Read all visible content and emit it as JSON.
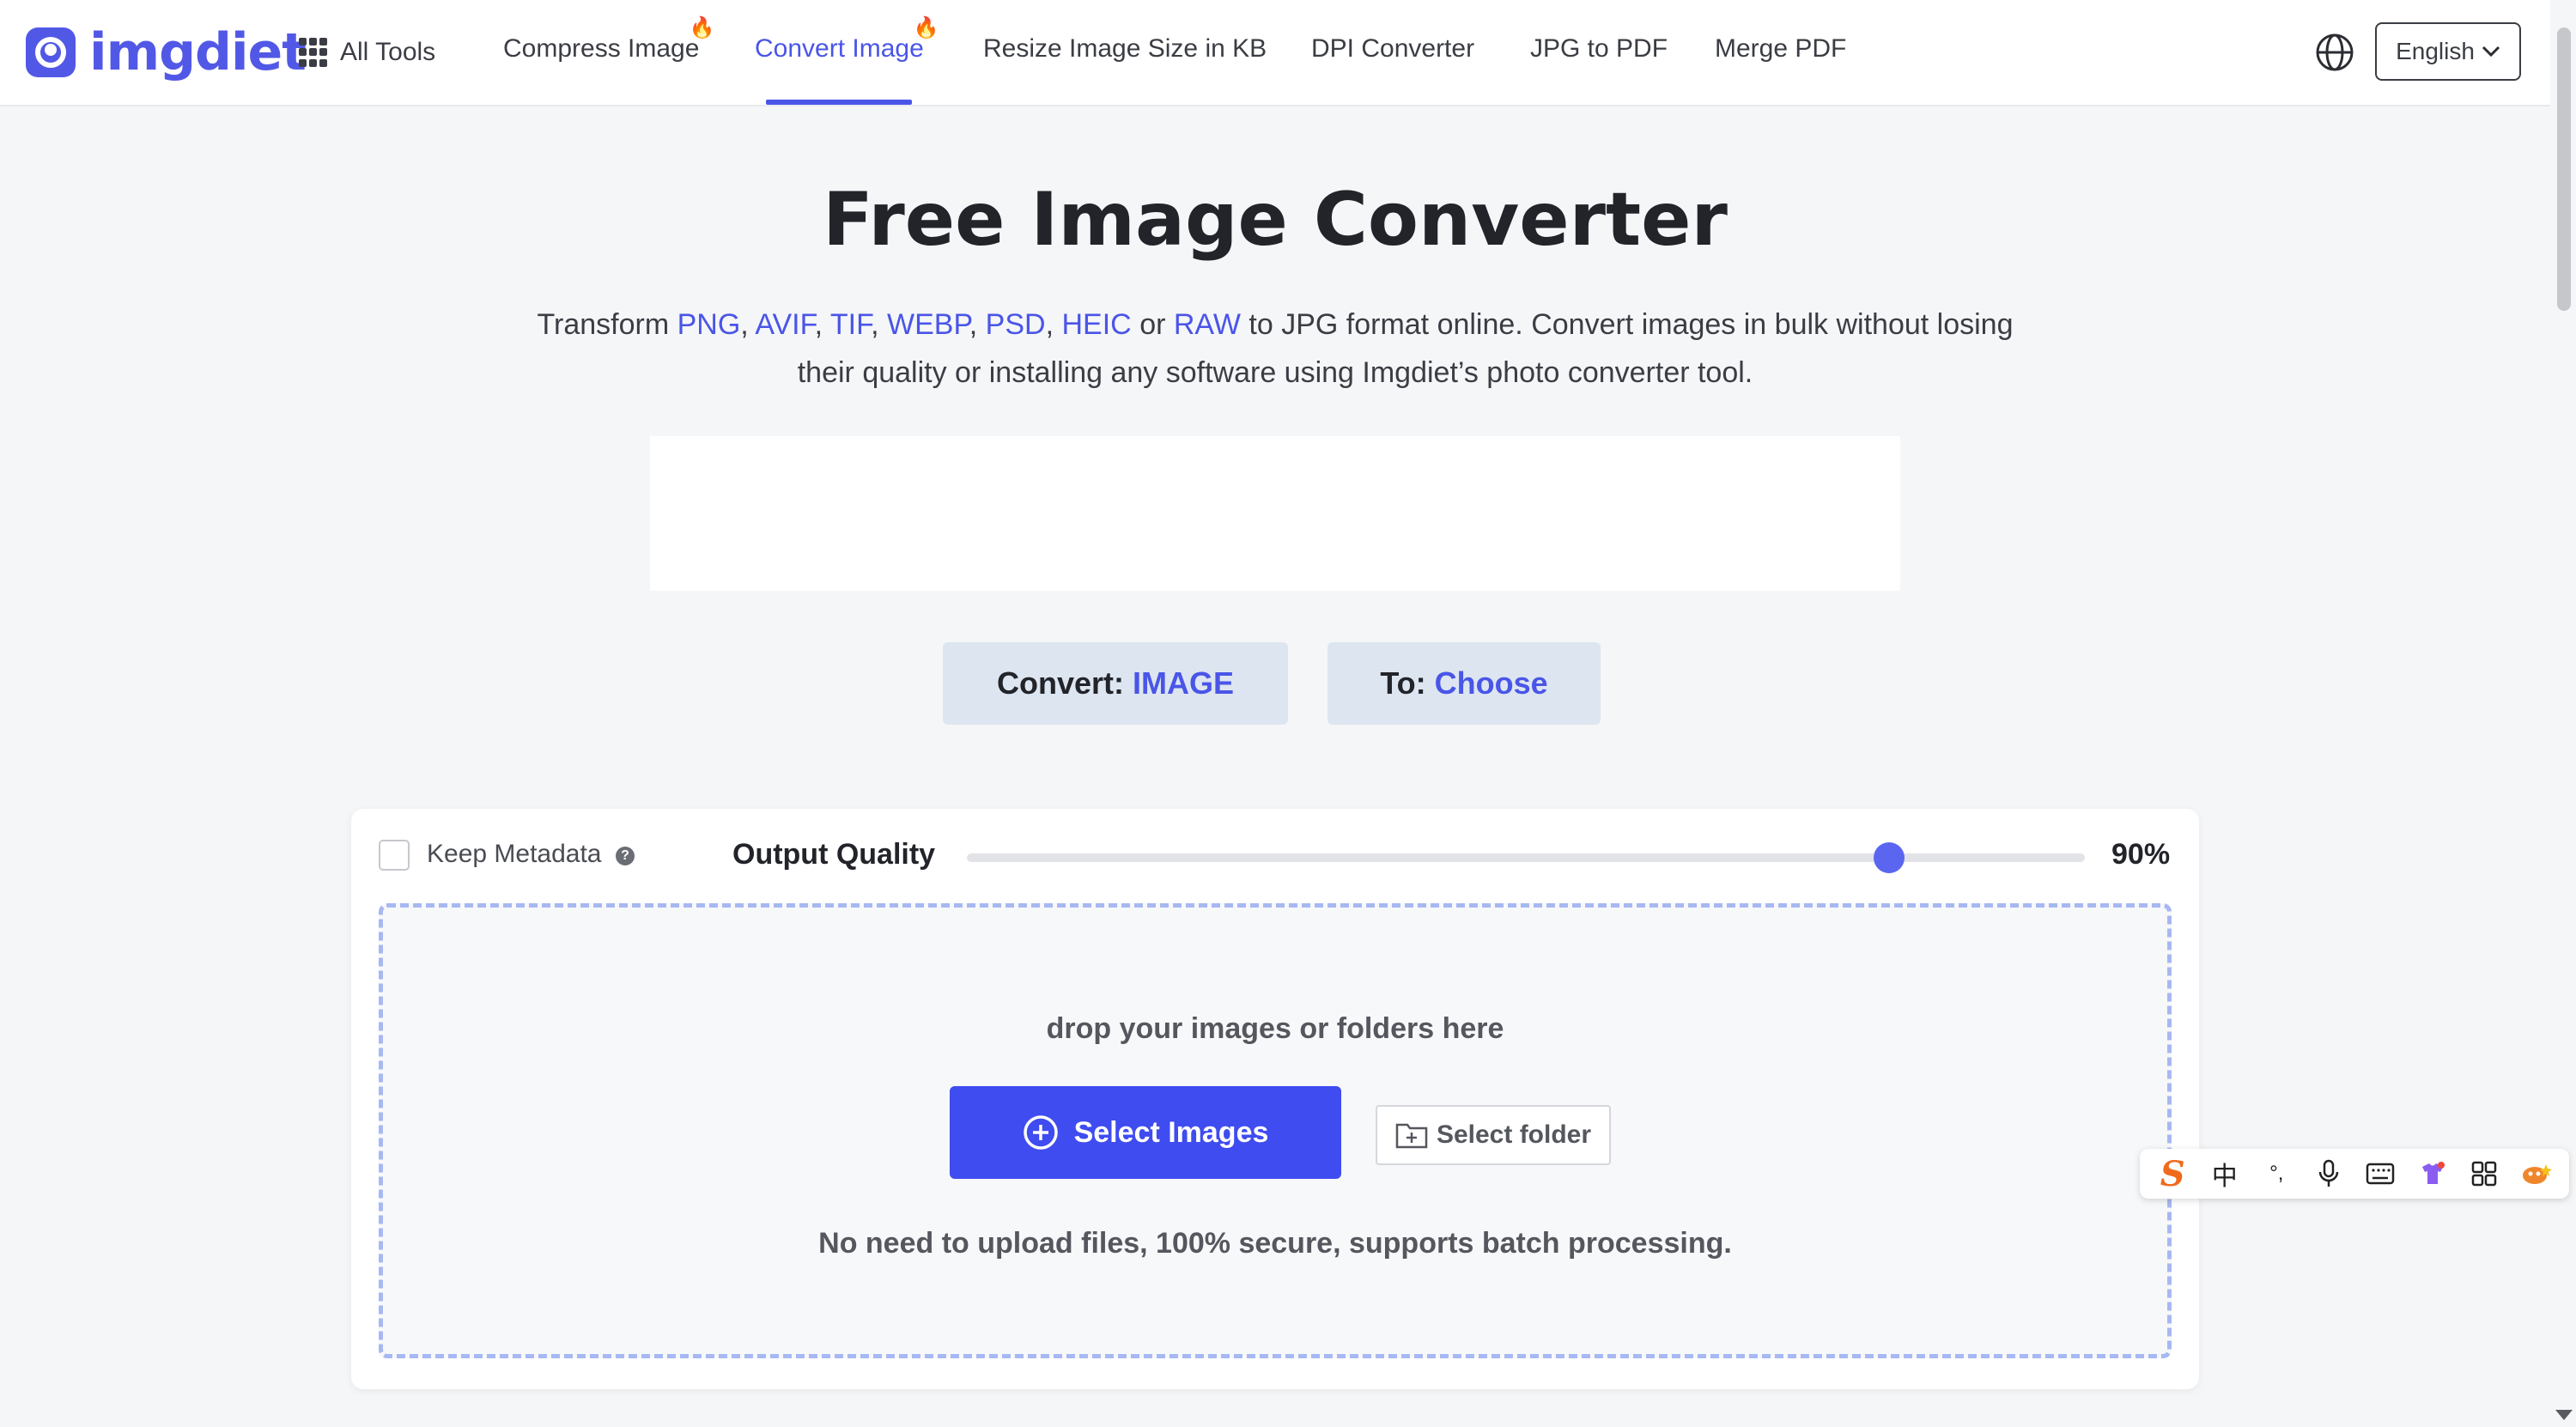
{
  "header": {
    "logo_text": "imgdiet",
    "all_tools_label": "All Tools",
    "nav": [
      {
        "label": "Compress Image",
        "hot": true
      },
      {
        "label": "Convert Image",
        "hot": true,
        "active": true
      },
      {
        "label": "Resize Image Size in KB"
      },
      {
        "label": "DPI Converter"
      },
      {
        "label": "JPG to PDF"
      },
      {
        "label": "Merge PDF"
      }
    ],
    "language": "English"
  },
  "hero": {
    "title": "Free Image Converter",
    "desc_prefix": "Transform",
    "formats": [
      "PNG",
      "AVIF",
      "TIF",
      "WEBP",
      "PSD",
      "HEIC"
    ],
    "or_word": "or",
    "last_format": "RAW",
    "desc_suffix": "to JPG format online. Convert images in bulk without losing their quality or installing any software using Imgdiet’s photo converter tool."
  },
  "converter": {
    "convert_label": "Convert:",
    "convert_value": "IMAGE",
    "to_label": "To:",
    "to_value": "Choose"
  },
  "card": {
    "keep_metadata_label": "Keep Metadata",
    "keep_metadata_checked": false,
    "output_quality_label": "Output Quality",
    "quality_value": 90,
    "quality_display": "90%",
    "drop_text": "drop your images or folders here",
    "select_images_label": "Select Images",
    "select_folder_label": "Select folder",
    "secure_text": "No need to upload files, 100% secure, supports batch processing."
  },
  "ime": {
    "logo": "S",
    "lang_char": "中",
    "punct_char": "°,"
  },
  "colors": {
    "accent": "#4a55e8",
    "primary_button": "#3f4cf0",
    "convert_button_bg": "#dde6f0",
    "page_bg": "#f5f6f8"
  },
  "icons": [
    "grid-icon",
    "fire-icon",
    "globe-icon",
    "chevron-down-icon",
    "help-icon",
    "plus-circle-icon",
    "folder-add-icon",
    "microphone-icon",
    "keyboard-icon",
    "apps-icon"
  ]
}
